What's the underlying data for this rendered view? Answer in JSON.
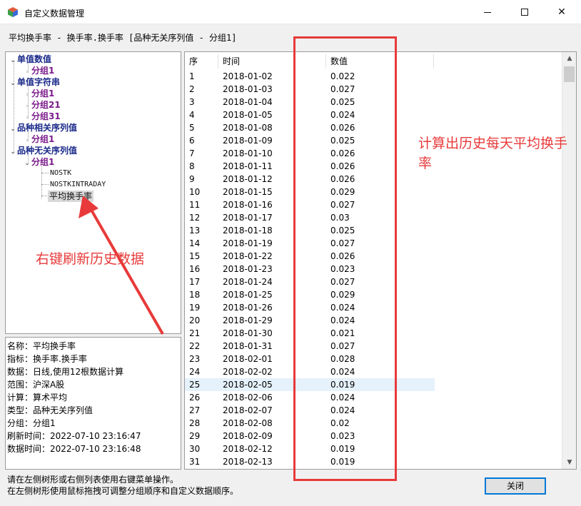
{
  "window": {
    "title": "自定义数据管理",
    "controls": {
      "minimize": "minimize-icon",
      "maximize": "maximize-icon",
      "close": "close-icon"
    }
  },
  "path_label": "平均换手率 - 换手率.换手率 [品种无关序列值 - 分组1]",
  "tree": {
    "nodes": [
      {
        "label": "单值数值",
        "type": "root",
        "expanded": true
      },
      {
        "label": "分组1",
        "type": "group",
        "expanded": false
      },
      {
        "label": "单值字符串",
        "type": "root",
        "expanded": true
      },
      {
        "label": "分组1",
        "type": "group",
        "expanded": false
      },
      {
        "label": "分组21",
        "type": "group",
        "expanded": false
      },
      {
        "label": "分组31",
        "type": "group",
        "expanded": false
      },
      {
        "label": "品种相关序列值",
        "type": "root",
        "expanded": true
      },
      {
        "label": "分组1",
        "type": "group",
        "expanded": false
      },
      {
        "label": "品种无关序列值",
        "type": "root",
        "expanded": true
      },
      {
        "label": "分组1",
        "type": "group",
        "expanded": true
      },
      {
        "label": "NOSTK",
        "type": "leaf"
      },
      {
        "label": "NOSTKINTRADAY",
        "type": "leaf"
      },
      {
        "label": "平均换手率",
        "type": "leaf",
        "selected": true
      }
    ]
  },
  "info": [
    "名称：平均换手率",
    "指标：换手率.换手率",
    "数据：日线,使用12根数据计算",
    "范围：沪深A股",
    "计算：算术平均",
    "类型：品种无关序列值",
    "分组：分组1",
    "刷新时间：2022-07-10 23:16:47",
    "数据时间：2022-07-10 23:16:48"
  ],
  "list": {
    "headers": {
      "seq": "序",
      "time": "时间",
      "value": "数值"
    },
    "selected_index": 25,
    "rows": [
      [
        "1",
        "2018-01-02",
        "0.022"
      ],
      [
        "2",
        "2018-01-03",
        "0.027"
      ],
      [
        "3",
        "2018-01-04",
        "0.025"
      ],
      [
        "4",
        "2018-01-05",
        "0.024"
      ],
      [
        "5",
        "2018-01-08",
        "0.026"
      ],
      [
        "6",
        "2018-01-09",
        "0.025"
      ],
      [
        "7",
        "2018-01-10",
        "0.026"
      ],
      [
        "8",
        "2018-01-11",
        "0.026"
      ],
      [
        "9",
        "2018-01-12",
        "0.026"
      ],
      [
        "10",
        "2018-01-15",
        "0.029"
      ],
      [
        "11",
        "2018-01-16",
        "0.027"
      ],
      [
        "12",
        "2018-01-17",
        "0.03"
      ],
      [
        "13",
        "2018-01-18",
        "0.025"
      ],
      [
        "14",
        "2018-01-19",
        "0.027"
      ],
      [
        "15",
        "2018-01-22",
        "0.026"
      ],
      [
        "16",
        "2018-01-23",
        "0.023"
      ],
      [
        "17",
        "2018-01-24",
        "0.027"
      ],
      [
        "18",
        "2018-01-25",
        "0.029"
      ],
      [
        "19",
        "2018-01-26",
        "0.024"
      ],
      [
        "20",
        "2018-01-29",
        "0.024"
      ],
      [
        "21",
        "2018-01-30",
        "0.021"
      ],
      [
        "22",
        "2018-01-31",
        "0.027"
      ],
      [
        "23",
        "2018-02-01",
        "0.028"
      ],
      [
        "24",
        "2018-02-02",
        "0.024"
      ],
      [
        "25",
        "2018-02-05",
        "0.019"
      ],
      [
        "26",
        "2018-02-06",
        "0.024"
      ],
      [
        "27",
        "2018-02-07",
        "0.024"
      ],
      [
        "28",
        "2018-02-08",
        "0.02"
      ],
      [
        "29",
        "2018-02-09",
        "0.023"
      ],
      [
        "30",
        "2018-02-12",
        "0.019"
      ],
      [
        "31",
        "2018-02-13",
        "0.019"
      ]
    ]
  },
  "annotations": {
    "right_text": "计算出历史每天平均换手率",
    "left_text": "右键刷新历史数据",
    "color": "#e83a3a"
  },
  "footer": {
    "line1": "请在左侧树形或右侧列表使用右键菜单操作。",
    "line2": "在左侧树形使用鼠标拖拽可调整分组顺序和自定义数据顺序。"
  },
  "buttons": {
    "close": "关闭"
  }
}
